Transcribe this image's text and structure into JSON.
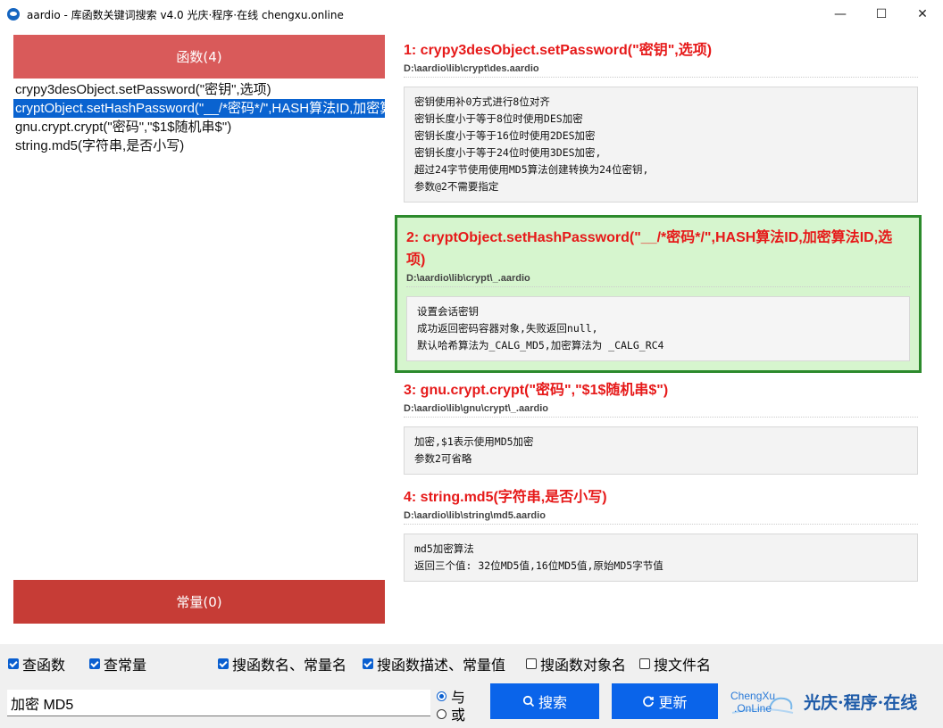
{
  "window": {
    "title": "aardio - 库函数关键词搜索 v4.0 光庆·程序·在线 chengxu.online",
    "minimize_glyph": "—",
    "maximize_glyph": "☐",
    "close_glyph": "✕"
  },
  "left": {
    "functions_header": "函数(4)",
    "functions": [
      "crypy3desObject.setPassword(\"密钥\",选项)",
      "cryptObject.setHashPassword(\"__/*密码*/\",HASH算法ID,加密算法ID,选项)",
      "gnu.crypt.crypt(\"密码\",\"$1$随机串$\")",
      "string.md5(字符串,是否小写)"
    ],
    "constants_header": "常量(0)"
  },
  "results": [
    {
      "title": "1: crypy3desObject.setPassword(\"密钥\",选项)",
      "path": "D:\\aardio\\lib\\crypt\\des.aardio",
      "desc": [
        "密钥使用补0方式进行8位对齐",
        "密钥长度小于等于8位时使用DES加密",
        "密钥长度小于等于16位时使用2DES加密",
        "密钥长度小于等于24位时使用3DES加密,",
        "超过24字节使用使用MD5算法创建转换为24位密钥,",
        "参数@2不需要指定"
      ]
    },
    {
      "title": "2: cryptObject.setHashPassword(\"__/*密码*/\",HASH算法ID,加密算法ID,选项)",
      "path": "D:\\aardio\\lib\\crypt\\_.aardio",
      "desc": [
        "设置会话密钥",
        "成功返回密码容器对象,失败返回null,",
        "默认哈希算法为_CALG_MD5,加密算法为 _CALG_RC4"
      ]
    },
    {
      "title": "3: gnu.crypt.crypt(\"密码\",\"$1$随机串$\")",
      "path": "D:\\aardio\\lib\\gnu\\crypt\\_.aardio",
      "desc": [
        "加密,$1表示使用MD5加密",
        "参数2可省略"
      ]
    },
    {
      "title": "4: string.md5(字符串,是否小写)",
      "path": "D:\\aardio\\lib\\string\\md5.aardio",
      "desc": [
        "md5加密算法",
        "返回三个值: 32位MD5值,16位MD5值,原始MD5字节值"
      ]
    }
  ],
  "options": {
    "check_functions": {
      "label": "查函数",
      "checked": true
    },
    "check_constants": {
      "label": "查常量",
      "checked": true
    },
    "search_names": {
      "label": "搜函数名、常量名",
      "checked": true
    },
    "search_desc": {
      "label": "搜函数描述、常量值",
      "checked": true
    },
    "search_object": {
      "label": "搜函数对象名",
      "checked": false
    },
    "search_file": {
      "label": "搜文件名",
      "checked": false
    }
  },
  "search": {
    "value": "加密 MD5",
    "mode_and": "与",
    "mode_or": "或",
    "search_button": "搜索",
    "refresh_button": "更新"
  },
  "logo": {
    "mark_line1": "ChengXu",
    "mark_line2": ".OnLine",
    "text": "光庆·程序·在线"
  }
}
